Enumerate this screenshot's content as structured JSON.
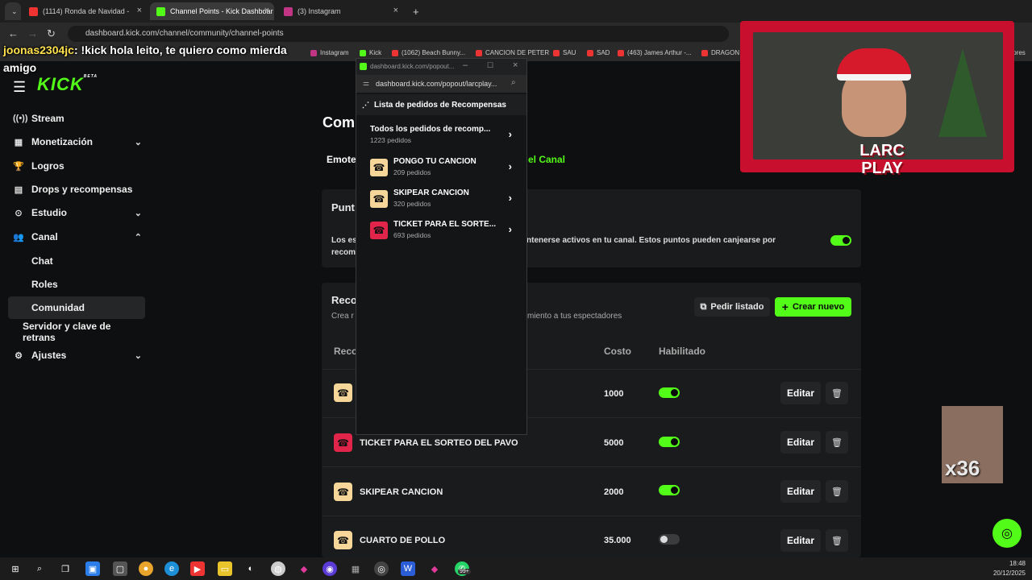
{
  "browser": {
    "tabs": [
      {
        "title": "(1114) Ronda de Navidad -"
      },
      {
        "title": "Channel Points - Kick Dashboar"
      },
      {
        "title": "(3) Instagram"
      }
    ],
    "url": "dashboard.kick.com/channel/community/channel-points",
    "bookmarks": [
      "Instagram",
      "Kick",
      "(1062) Beach Bunny...",
      "CANCION DE PETER",
      "SAU",
      "SAD",
      "(463) James Arthur -...",
      "DRAGON BA",
      "idores"
    ]
  },
  "stream_overlay": {
    "chat_line_user": "joonas2304jc",
    "chat_line_text": ": !kick hola leito, te quiero como mierda",
    "chat_line_2": "amigo",
    "webcam_label": "LARC PLAY",
    "emote_count": "x36"
  },
  "sidebar": {
    "logo": "KICK",
    "logo_badge": "BETA",
    "items": [
      {
        "label": "Stream",
        "icon": "broadcast-icon"
      },
      {
        "label": "Monetización",
        "icon": "monetization-icon"
      },
      {
        "label": "Logros",
        "icon": "trophy-icon"
      },
      {
        "label": "Drops y recompensas",
        "icon": "gift-icon"
      },
      {
        "label": "Estudio",
        "icon": "studio-icon"
      },
      {
        "label": "Canal",
        "icon": "users-icon"
      }
    ],
    "canal_sub": [
      {
        "label": "Chat"
      },
      {
        "label": "Roles"
      },
      {
        "label": "Comunidad"
      }
    ],
    "extra": "Servidor y clave de retrans",
    "settings": "Ajustes"
  },
  "main": {
    "page_title": "Comu",
    "tabs": [
      "Emote",
      "el Canal"
    ],
    "points_card": {
      "title": "Punt",
      "desc_left": "Los es",
      "desc_right": "ntenerse activos en tu canal. Estos puntos pueden canjearse por",
      "desc_line2": "recom",
      "enabled": true
    },
    "rewards_card": {
      "title": "Reco",
      "subtitle_left": "Crea r",
      "subtitle_right": "miento a tus espectadores",
      "pedir_listado": "Pedir listado",
      "crear_nuevo": "Crear nuevo",
      "col_reward": "Reco",
      "col_cost": "Costo",
      "col_enabled": "Habilitado"
    },
    "rewards": [
      {
        "name": "",
        "cost": "1000",
        "enabled": true,
        "color": "yellow"
      },
      {
        "name": "TICKET PARA EL SORTEO DEL PAVO",
        "cost": "5000",
        "enabled": true,
        "color": "red"
      },
      {
        "name": "SKIPEAR CANCION",
        "cost": "2000",
        "enabled": true,
        "color": "yellow"
      },
      {
        "name": "CUARTO DE POLLO",
        "cost": "35.000",
        "enabled": false,
        "color": "yellow"
      }
    ],
    "edit_label": "Editar"
  },
  "popup": {
    "title_url": "dashboard.kick.com/popout...",
    "url": "dashboard.kick.com/popout/larcplay...",
    "header": "Lista de pedidos de Recompensas",
    "items": [
      {
        "title": "Todos los pedidos de recomp...",
        "count": "1223 pedidos",
        "color": "none"
      },
      {
        "title": "PONGO TU CANCION",
        "count": "209 pedidos",
        "color": "yellow"
      },
      {
        "title": "SKIPEAR CANCION",
        "count": "320 pedidos",
        "color": "yellow"
      },
      {
        "title": "TICKET PARA EL SORTE...",
        "count": "693 pedidos",
        "color": "red"
      }
    ]
  },
  "taskbar": {
    "time": "18:48",
    "date": "20/12/2025",
    "badge": "99+"
  }
}
